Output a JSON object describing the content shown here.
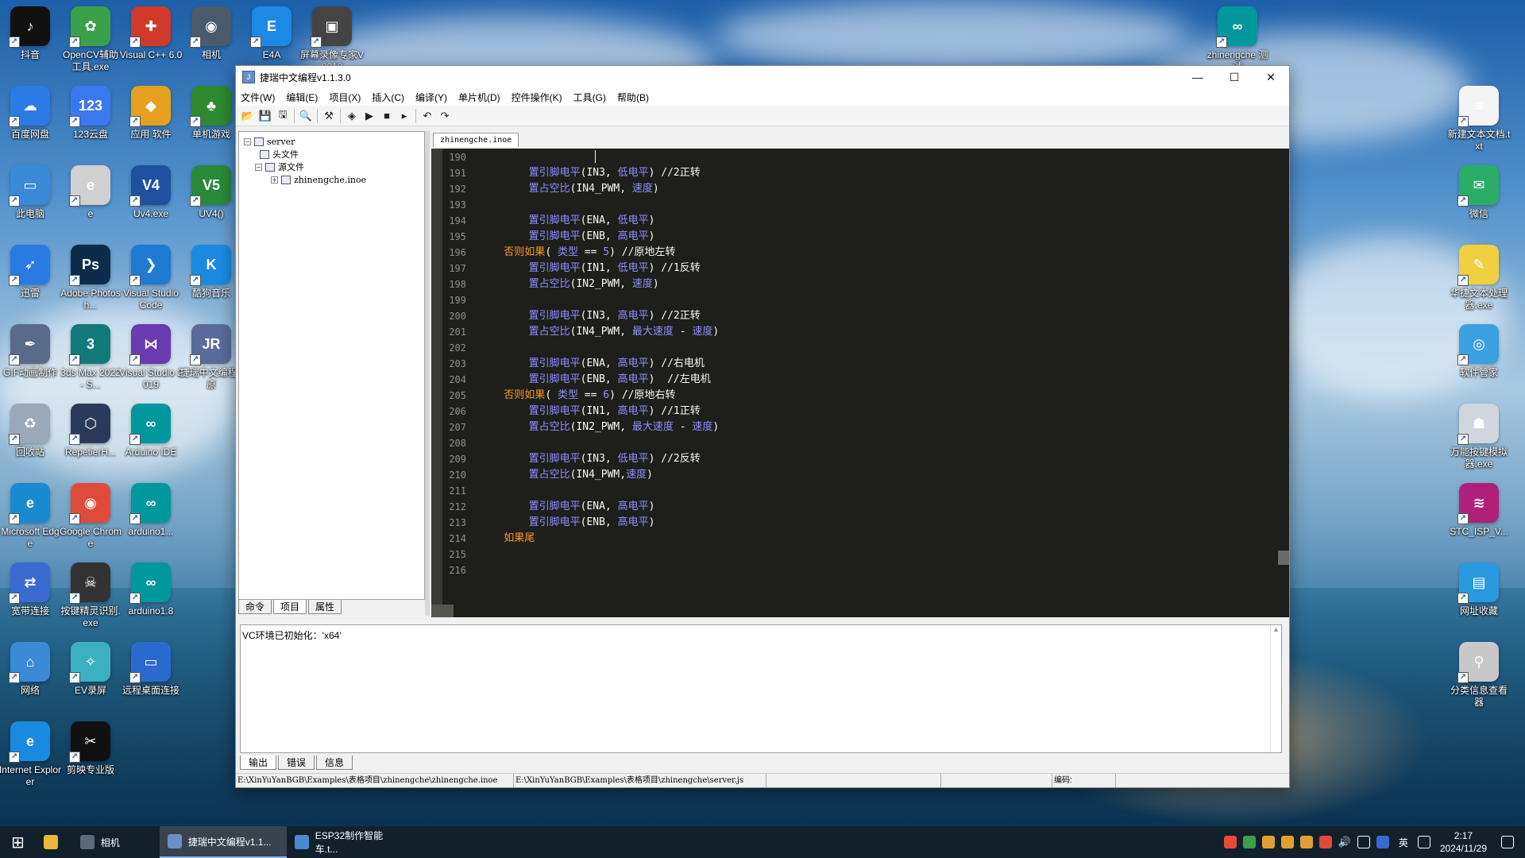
{
  "desktop": {
    "icons": [
      {
        "label": "抖音",
        "icon": "douyin-icon",
        "color": "#111111",
        "glyph": "♪"
      },
      {
        "label": "OpenCV辅助工具.exe",
        "icon": "opencv-tool-icon",
        "color": "#3aa04a",
        "glyph": "✿"
      },
      {
        "label": "Visual C++ 6.0",
        "icon": "visual-cpp-icon",
        "color": "#d03a2a",
        "glyph": "✚"
      },
      {
        "label": "相机",
        "icon": "camera-icon",
        "color": "#4a5a6a",
        "glyph": "◉"
      },
      {
        "label": "E4A",
        "icon": "e4a-icon",
        "color": "#1e88e5",
        "glyph": "E"
      },
      {
        "label": "屏幕录像专家V2019",
        "icon": "screen-recorder-icon",
        "color": "#444444",
        "glyph": "▣"
      },
      {
        "label": "zhinengche 测试",
        "icon": "arduino-icon",
        "color": "#00979d",
        "glyph": "∞"
      },
      {
        "label": "百度网盘",
        "icon": "baidu-netdisk-icon",
        "color": "#2a7be4",
        "glyph": "☁"
      },
      {
        "label": "123云盘",
        "icon": "cloud-123-icon",
        "color": "#3a78f0",
        "glyph": "123"
      },
      {
        "label": "应用 软件",
        "icon": "apps-icon",
        "color": "#e6a020",
        "glyph": "◆"
      },
      {
        "label": "单机游戏",
        "icon": "games-icon",
        "color": "#2f8a2f",
        "glyph": "♣"
      },
      {
        "label": "新建文本文档.txt",
        "icon": "text-file-icon",
        "color": "#f4f4f4",
        "glyph": "≡"
      },
      {
        "label": "此电脑",
        "icon": "this-pc-icon",
        "color": "#3a8ad8",
        "glyph": "▭"
      },
      {
        "label": "e",
        "icon": "e-language-icon",
        "color": "#d0d0d0",
        "glyph": "e"
      },
      {
        "label": "Uv4.exe",
        "icon": "uv4-icon",
        "color": "#2050a0",
        "glyph": "V4"
      },
      {
        "label": "UV4()",
        "icon": "uv4-green-icon",
        "color": "#2a8a3a",
        "glyph": "V5"
      },
      {
        "label": "微信",
        "icon": "wechat-icon",
        "color": "#2aae67",
        "glyph": "✉"
      },
      {
        "label": "迅雷",
        "icon": "xunlei-icon",
        "color": "#2a7ae4",
        "glyph": "➶"
      },
      {
        "label": "Adobe Photosh...",
        "icon": "photoshop-icon",
        "color": "#0b2c4a",
        "glyph": "Ps"
      },
      {
        "label": "Visual Studio Code",
        "icon": "vscode-icon",
        "color": "#1e7ad2",
        "glyph": "❯"
      },
      {
        "label": "酷狗音乐",
        "icon": "kugou-icon",
        "color": "#1a8ae0",
        "glyph": "K"
      },
      {
        "label": "华捷文本处理器.exe",
        "icon": "text-processor-icon",
        "color": "#f0d040",
        "glyph": "✎"
      },
      {
        "label": "GIF动画制作",
        "icon": "gif-maker-icon",
        "color": "#5a6a8a",
        "glyph": "✒"
      },
      {
        "label": "3ds Max 2022 - S...",
        "icon": "3dsmax-icon",
        "color": "#137a7a",
        "glyph": "3"
      },
      {
        "label": "Visual Studio 2019",
        "icon": "visual-studio-icon",
        "color": "#6a3ab0",
        "glyph": "⋈"
      },
      {
        "label": "捷瑞中文编程_原",
        "icon": "jierui-icon",
        "color": "#5a6a9a",
        "glyph": "JR"
      },
      {
        "label": "软件管家",
        "icon": "software-manager-icon",
        "color": "#3aa0e0",
        "glyph": "◎"
      },
      {
        "label": "回收站",
        "icon": "recycle-bin-icon",
        "color": "#9aa8b8",
        "glyph": "♻"
      },
      {
        "label": "RepetierH...",
        "icon": "repetier-icon",
        "color": "#2a3a5a",
        "glyph": "⬡"
      },
      {
        "label": "Arduino IDE",
        "icon": "arduino-ide-icon",
        "color": "#00979d",
        "glyph": "∞"
      },
      {
        "label": "万能按键模拟器.exe",
        "icon": "key-simulator-icon",
        "color": "#cfd6de",
        "glyph": "☗"
      },
      {
        "label": "Microsoft Edge",
        "icon": "edge-icon",
        "color": "#1a8ad0",
        "glyph": "e"
      },
      {
        "label": "Google Chrome",
        "icon": "chrome-icon",
        "color": "#e04a3a",
        "glyph": "◉"
      },
      {
        "label": "arduino1...",
        "icon": "arduino1-icon",
        "color": "#00979d",
        "glyph": "∞"
      },
      {
        "label": "STC_ISP_V...",
        "icon": "stc-isp-icon",
        "color": "#b0207a",
        "glyph": "≋"
      },
      {
        "label": "宽带连接",
        "icon": "broadband-icon",
        "color": "#3a6ad0",
        "glyph": "⇄"
      },
      {
        "label": "按键精灵识别.exe",
        "icon": "key-wizard-icon",
        "color": "#333333",
        "glyph": "☠"
      },
      {
        "label": "arduino1.8",
        "icon": "arduino18-icon",
        "color": "#00979d",
        "glyph": "∞"
      },
      {
        "label": "网址收藏",
        "icon": "bookmarks-icon",
        "color": "#2a9ae0",
        "glyph": "▤"
      },
      {
        "label": "网络",
        "icon": "network-icon",
        "color": "#3a8ad8",
        "glyph": "⌂"
      },
      {
        "label": "EV录屏",
        "icon": "ev-recorder-icon",
        "color": "#3ab0c0",
        "glyph": "✧"
      },
      {
        "label": "远程桌面连接",
        "icon": "remote-desktop-icon",
        "color": "#2a6ad0",
        "glyph": "▭"
      },
      {
        "label": "分类信息查看器",
        "icon": "info-viewer-icon",
        "color": "#c8c8c8",
        "glyph": "⚲"
      },
      {
        "label": "Internet Explorer",
        "icon": "ie-icon",
        "color": "#1a8ae0",
        "glyph": "e"
      },
      {
        "label": "剪映专业版",
        "icon": "jianying-icon",
        "color": "#111111",
        "glyph": "✂"
      }
    ]
  },
  "window": {
    "title": "捷瑞中文编程v1.1.3.0",
    "controls": {
      "minimize": "—",
      "maximize": "☐",
      "close": "✕"
    },
    "menu": [
      "文件(W)",
      "编辑(E)",
      "项目(X)",
      "插入(C)",
      "编译(Y)",
      "单片机(D)",
      "控件操作(K)",
      "工具(G)",
      "帮助(B)"
    ],
    "toolbar": [
      {
        "name": "open-icon",
        "glyph": "📂"
      },
      {
        "name": "save-icon",
        "glyph": "💾"
      },
      {
        "name": "save-all-icon",
        "glyph": "🖫"
      },
      {
        "name": "find-icon",
        "glyph": "🔍"
      },
      {
        "name": "tools-icon",
        "glyph": "⚒"
      },
      {
        "name": "compile-icon",
        "glyph": "◈"
      },
      {
        "name": "run-icon",
        "glyph": "▶"
      },
      {
        "name": "stop-icon",
        "glyph": "■"
      },
      {
        "name": "step-icon",
        "glyph": "▸"
      },
      {
        "name": "undo-icon",
        "glyph": "↶"
      },
      {
        "name": "redo-icon",
        "glyph": "↷"
      }
    ]
  },
  "project_tree": {
    "root": "server",
    "nodes": [
      {
        "label": "头文件",
        "level": 1
      },
      {
        "label": "源文件",
        "level": 1
      },
      {
        "label": "zhinengche.inoe",
        "level": 2
      }
    ],
    "tabs": [
      "命令",
      "项目",
      "属性"
    ],
    "active_tab": "项目"
  },
  "editor": {
    "tab": "zhinengche.inoe",
    "lines": [
      {
        "n": "190",
        "parts": []
      },
      {
        "n": "191",
        "parts": [
          [
            "fn",
            "        置引脚电平"
          ],
          [
            "txt",
            "(IN3, "
          ],
          [
            "fn",
            "低电平"
          ],
          [
            "txt",
            ") //2正转"
          ]
        ]
      },
      {
        "n": "192",
        "parts": [
          [
            "fn",
            "        置占空比"
          ],
          [
            "txt",
            "(IN4_PWM, "
          ],
          [
            "fn",
            "速度"
          ],
          [
            "txt",
            ")"
          ]
        ]
      },
      {
        "n": "193",
        "parts": []
      },
      {
        "n": "194",
        "parts": [
          [
            "fn",
            "        置引脚电平"
          ],
          [
            "txt",
            "(ENA, "
          ],
          [
            "fn",
            "低电平"
          ],
          [
            "txt",
            ")"
          ]
        ]
      },
      {
        "n": "195",
        "parts": [
          [
            "fn",
            "        置引脚电平"
          ],
          [
            "txt",
            "(ENB, "
          ],
          [
            "fn",
            "高电平"
          ],
          [
            "txt",
            ")"
          ]
        ]
      },
      {
        "n": "196",
        "parts": [
          [
            "kw",
            "    否则如果"
          ],
          [
            "txt",
            "( "
          ],
          [
            "fn",
            "类型"
          ],
          [
            "txt",
            " == "
          ],
          [
            "num",
            "5"
          ],
          [
            "txt",
            ") //原地左转"
          ]
        ]
      },
      {
        "n": "197",
        "parts": [
          [
            "fn",
            "        置引脚电平"
          ],
          [
            "txt",
            "(IN1, "
          ],
          [
            "fn",
            "低电平"
          ],
          [
            "txt",
            ") //1反转"
          ]
        ]
      },
      {
        "n": "198",
        "parts": [
          [
            "fn",
            "        置占空比"
          ],
          [
            "txt",
            "(IN2_PWM, "
          ],
          [
            "fn",
            "速度"
          ],
          [
            "txt",
            ")"
          ]
        ]
      },
      {
        "n": "199",
        "parts": []
      },
      {
        "n": "200",
        "parts": [
          [
            "fn",
            "        置引脚电平"
          ],
          [
            "txt",
            "(IN3, "
          ],
          [
            "fn",
            "高电平"
          ],
          [
            "txt",
            ") //2正转"
          ]
        ]
      },
      {
        "n": "201",
        "parts": [
          [
            "fn",
            "        置占空比"
          ],
          [
            "txt",
            "(IN4_PWM, "
          ],
          [
            "fn",
            "最大速度"
          ],
          [
            "txt",
            " - "
          ],
          [
            "fn",
            "速度"
          ],
          [
            "txt",
            ")"
          ]
        ]
      },
      {
        "n": "202",
        "parts": []
      },
      {
        "n": "203",
        "parts": [
          [
            "fn",
            "        置引脚电平"
          ],
          [
            "txt",
            "(ENA, "
          ],
          [
            "fn",
            "高电平"
          ],
          [
            "txt",
            ") //右电机"
          ]
        ]
      },
      {
        "n": "204",
        "parts": [
          [
            "fn",
            "        置引脚电平"
          ],
          [
            "txt",
            "(ENB, "
          ],
          [
            "fn",
            "高电平"
          ],
          [
            "txt",
            ")  //左电机"
          ]
        ]
      },
      {
        "n": "205",
        "parts": [
          [
            "kw",
            "    否则如果"
          ],
          [
            "txt",
            "( "
          ],
          [
            "fn",
            "类型"
          ],
          [
            "txt",
            " == "
          ],
          [
            "num",
            "6"
          ],
          [
            "txt",
            ") //原地右转"
          ]
        ]
      },
      {
        "n": "206",
        "parts": [
          [
            "fn",
            "        置引脚电平"
          ],
          [
            "txt",
            "(IN1, "
          ],
          [
            "fn",
            "高电平"
          ],
          [
            "txt",
            ") //1正转"
          ]
        ]
      },
      {
        "n": "207",
        "parts": [
          [
            "fn",
            "        置占空比"
          ],
          [
            "txt",
            "(IN2_PWM, "
          ],
          [
            "fn",
            "最大速度"
          ],
          [
            "txt",
            " - "
          ],
          [
            "fn",
            "速度"
          ],
          [
            "txt",
            ")"
          ]
        ]
      },
      {
        "n": "208",
        "parts": []
      },
      {
        "n": "209",
        "parts": [
          [
            "fn",
            "        置引脚电平"
          ],
          [
            "txt",
            "(IN3, "
          ],
          [
            "fn",
            "低电平"
          ],
          [
            "txt",
            ") //2反转"
          ]
        ]
      },
      {
        "n": "210",
        "parts": [
          [
            "fn",
            "        置占空比"
          ],
          [
            "txt",
            "(IN4_PWM,"
          ],
          [
            "fn",
            "速度"
          ],
          [
            "txt",
            ")"
          ]
        ]
      },
      {
        "n": "211",
        "parts": []
      },
      {
        "n": "212",
        "parts": [
          [
            "fn",
            "        置引脚电平"
          ],
          [
            "txt",
            "(ENA, "
          ],
          [
            "fn",
            "高电平"
          ],
          [
            "txt",
            ")"
          ]
        ]
      },
      {
        "n": "213",
        "parts": [
          [
            "fn",
            "        置引脚电平"
          ],
          [
            "txt",
            "(ENB, "
          ],
          [
            "fn",
            "高电平"
          ],
          [
            "txt",
            ")"
          ]
        ]
      },
      {
        "n": "214",
        "parts": [
          [
            "kw",
            "    如果尾"
          ]
        ]
      },
      {
        "n": "215",
        "parts": []
      },
      {
        "n": "216",
        "parts": []
      }
    ]
  },
  "output": {
    "text": "VC环境已初始化：'x64'",
    "tabs": [
      "输出",
      "错误",
      "信息"
    ],
    "active_tab": "输出"
  },
  "statusbar": {
    "path1": "E:\\XinYuYanBGB\\Examples\\表格项目\\zhinengche\\zhinengche.inoe",
    "path2": "E:\\XinYuYanBGB\\Examples\\表格项目\\zhinengche\\server.js",
    "encoding_label": "编码:"
  },
  "taskbar": {
    "start": "⊞",
    "items": [
      {
        "label": "相机",
        "icon": "camera-icon",
        "active": false
      },
      {
        "label": "捷瑞中文编程v1.1...",
        "icon": "jierui-icon",
        "active": true
      },
      {
        "label": "ESP32制作智能车.t...",
        "icon": "text-editor-icon",
        "active": false
      }
    ],
    "ime": "英",
    "time": "2:17",
    "date": "2024/11/29"
  },
  "colors": {
    "editor_bg": "#1e1f1b",
    "keyword": "#fd971f",
    "function": "#8f8fff",
    "number": "#ae81ff",
    "text": "#f8f8f2",
    "line_number": "#8f908a"
  }
}
